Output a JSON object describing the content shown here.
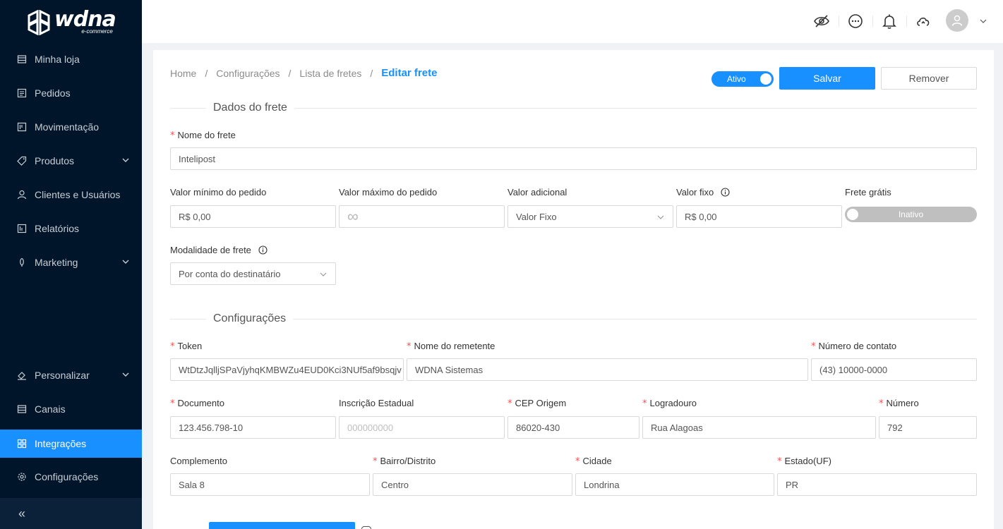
{
  "brand": {
    "name": "wdna",
    "tagline": "e-commerce"
  },
  "sidebar": {
    "items": [
      {
        "label": "Minha loja",
        "icon": "store-icon"
      },
      {
        "label": "Pedidos",
        "icon": "orders-icon"
      },
      {
        "label": "Movimentação",
        "icon": "movement-icon"
      },
      {
        "label": "Produtos",
        "icon": "tag-icon"
      },
      {
        "label": "Clientes e Usuários",
        "icon": "user-icon"
      },
      {
        "label": "Relatórios",
        "icon": "reports-icon"
      },
      {
        "label": "Marketing",
        "icon": "marketing-icon"
      },
      {
        "label": "Personalizar",
        "icon": "paint-icon"
      },
      {
        "label": "Canais",
        "icon": "channels-icon"
      },
      {
        "label": "Integrações",
        "icon": "grid-icon"
      },
      {
        "label": "Configurações",
        "icon": "gear-icon"
      }
    ],
    "collapse_label": "«",
    "active_color": "#1890ff"
  },
  "breadcrumb": {
    "items": [
      "Home",
      "Configurações",
      "Lista de fretes"
    ],
    "separator": "/",
    "current": "Editar frete"
  },
  "actions": {
    "status_label": "Ativo",
    "save_label": "Salvar",
    "remove_label": "Remover"
  },
  "section_freight": {
    "title": "Dados do frete",
    "name_label": "Nome do frete",
    "name_value": "Intelipost",
    "min_label": "Valor mínimo do pedido",
    "min_value": "R$ 0,00",
    "max_label": "Valor máximo do pedido",
    "max_placeholder": "∞",
    "additional_label": "Valor adicional",
    "additional_value": "Valor Fixo",
    "fixed_label": "Valor fixo",
    "fixed_value": "R$ 0,00",
    "free_label": "Frete grátis",
    "free_status": "Inativo",
    "modality_label": "Modalidade de frete",
    "modality_value": "Por conta do destinatário"
  },
  "section_config": {
    "title": "Configurações",
    "token_label": "Token",
    "token_value": "WtDtzJqlljSPaVjyhqKMBWZu4EUD0Kci3NUf5af9bsqjv",
    "sender_label": "Nome do remetente",
    "sender_value": "WDNA Sistemas",
    "contact_label": "Número de contato",
    "contact_value": "(43) 10000-0000",
    "document_label": "Documento",
    "document_value": "123.456.798-10",
    "ie_label": "Inscrição Estadual",
    "ie_placeholder": "000000000",
    "cep_label": "CEP Origem",
    "cep_value": "86020-430",
    "street_label": "Logradouro",
    "street_value": "Rua Alagoas",
    "number_label": "Número",
    "number_value": "792",
    "complement_label": "Complemento",
    "complement_value": "Sala 8",
    "district_label": "Bairro/Distrito",
    "district_value": "Centro",
    "city_label": "Cidade",
    "city_value": "Londrina",
    "state_label": "Estado(UF)",
    "state_value": "PR"
  }
}
